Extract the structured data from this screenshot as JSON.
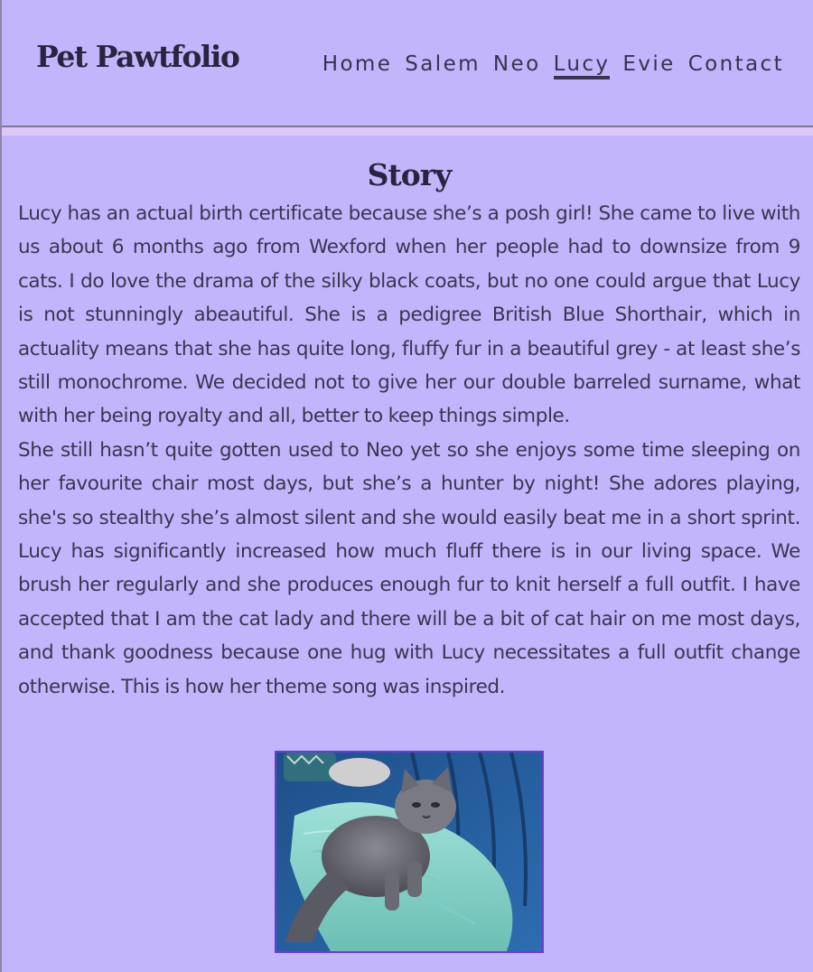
{
  "header": {
    "brand": "Pet Pawtfolio",
    "nav": [
      {
        "label": "Home",
        "active": false
      },
      {
        "label": "Salem",
        "active": false
      },
      {
        "label": "Neo",
        "active": false
      },
      {
        "label": "Lucy",
        "active": true
      },
      {
        "label": "Evie",
        "active": false
      },
      {
        "label": "Contact",
        "active": false
      }
    ]
  },
  "main": {
    "heading": "Story",
    "paragraphs": [
      "Lucy has an actual birth certificate because she’s a posh girl! She came to live with us about 6 months ago from Wexford when her people had to downsize from 9 cats. I do love the drama of the silky black coats, but no one could argue that Lucy is not stunningly abeautiful. She is a pedigree British Blue Shorthair, which in actuality means that she has quite long, fluffy fur in a beautiful grey - at least she’s still monochrome. We decided not to give her our double barreled surname, what with her being royalty and all, better to keep things simple.",
      "She still hasn’t quite gotten used to Neo yet so she enjoys some time sleeping on her favourite chair most days, but she’s a hunter by night! She adores playing, she's so stealthy she’s almost silent and she would easily beat me in a short sprint. Lucy has significantly increased how much fluff there is in our living space. We brush her regularly and she produces enough fur to knit herself a full outfit. I have accepted that I am the cat lady and there will be a bit of cat hair on me most days, and thank goodness because one hug with Lucy necessitates a full outfit change otherwise. This is how her theme song was inspired."
    ]
  },
  "colors": {
    "background": "#c3b5fb",
    "stripe": "#ddc8f8",
    "text": "#3a3550",
    "photo_border": "#6a3fd0"
  }
}
